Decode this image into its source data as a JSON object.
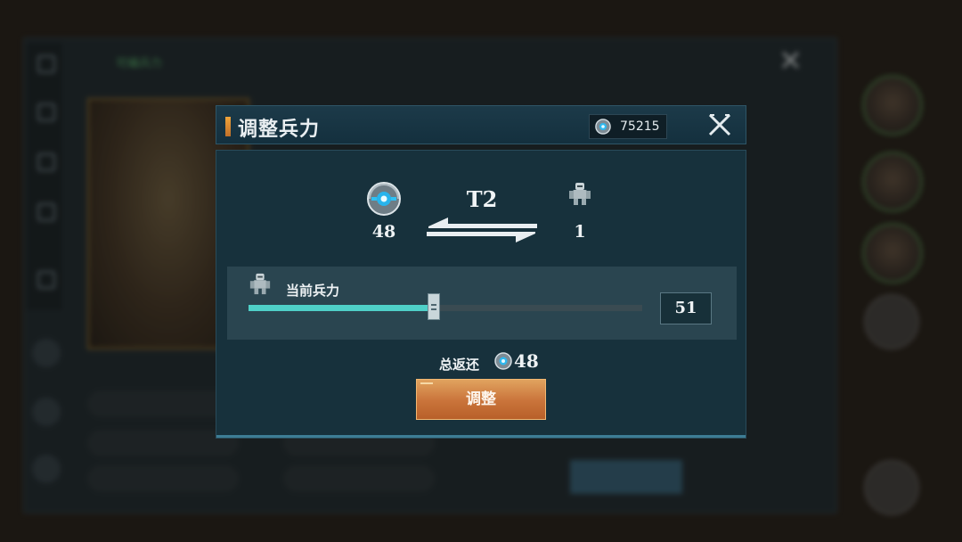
{
  "background": {
    "tab_label": "可编兵力"
  },
  "modal": {
    "title": "调整兵力",
    "currency": {
      "icon": "orb-icon",
      "value": "75215"
    },
    "close_icon": "close-icon",
    "conversion": {
      "orb_count": "48",
      "tier": "T2",
      "troop_count": "1"
    },
    "strength": {
      "label": "当前兵力",
      "value": "51",
      "slider_fraction": 0.47,
      "accent_color": "#4fd0c8"
    },
    "refund": {
      "label": "总返还",
      "value": "48"
    },
    "adjust_button": "调整",
    "button_color": "#c9733a"
  }
}
